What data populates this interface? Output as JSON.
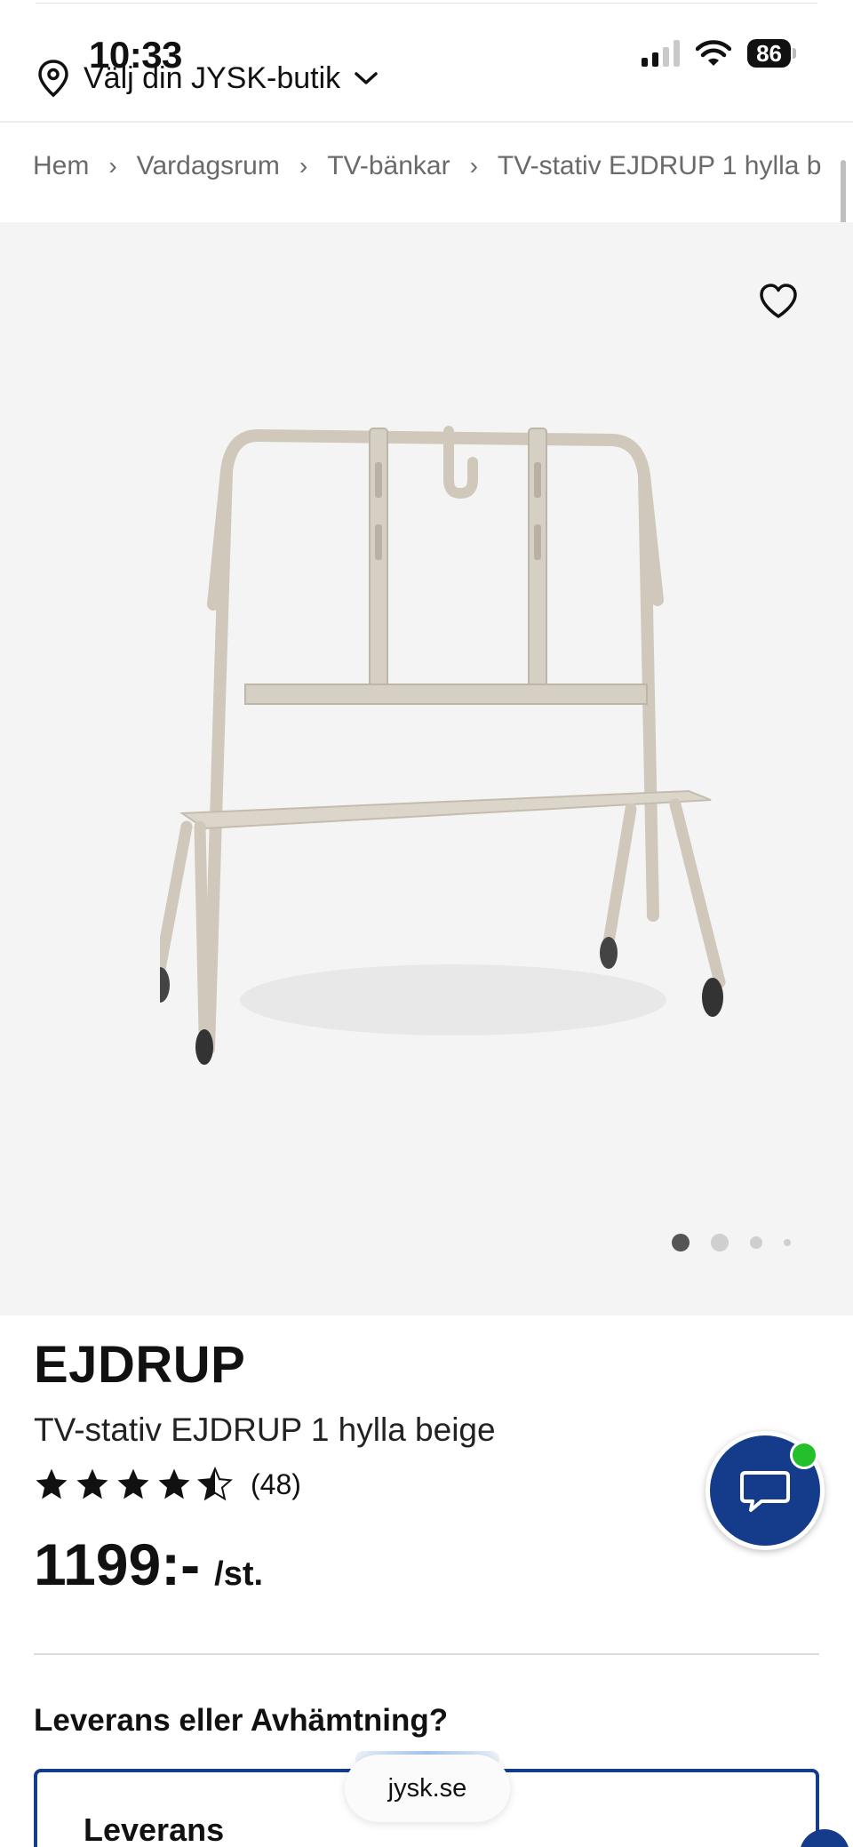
{
  "status_bar": {
    "time": "10:33",
    "battery": "86",
    "icons": [
      "signal-icon",
      "wifi-icon",
      "battery-icon"
    ]
  },
  "header": {
    "store_selector_label": "Välj din JYSK-butik",
    "icons": [
      "location-pin-icon",
      "chevron-down-icon"
    ]
  },
  "breadcrumb": {
    "items": [
      "Hem",
      "Vardagsrum",
      "TV-bänkar",
      "TV-stativ EJDRUP 1 hylla b"
    ]
  },
  "gallery": {
    "dot_count": 4,
    "active_index": 0,
    "background": "#f4f4f4"
  },
  "product": {
    "brand": "EJDRUP",
    "name": "TV-stativ EJDRUP 1 hylla beige",
    "rating": 4.5,
    "rating_count": "(48)",
    "price": "1199:-",
    "unit": "/st."
  },
  "delivery": {
    "heading": "Leverans eller Avhämtning?",
    "option_title": "Leverans"
  },
  "browser": {
    "url": "jysk.se"
  },
  "colors": {
    "brand_blue": "#143c8a",
    "online_green": "#23c02c",
    "product_beige": "#cfc8bb"
  }
}
